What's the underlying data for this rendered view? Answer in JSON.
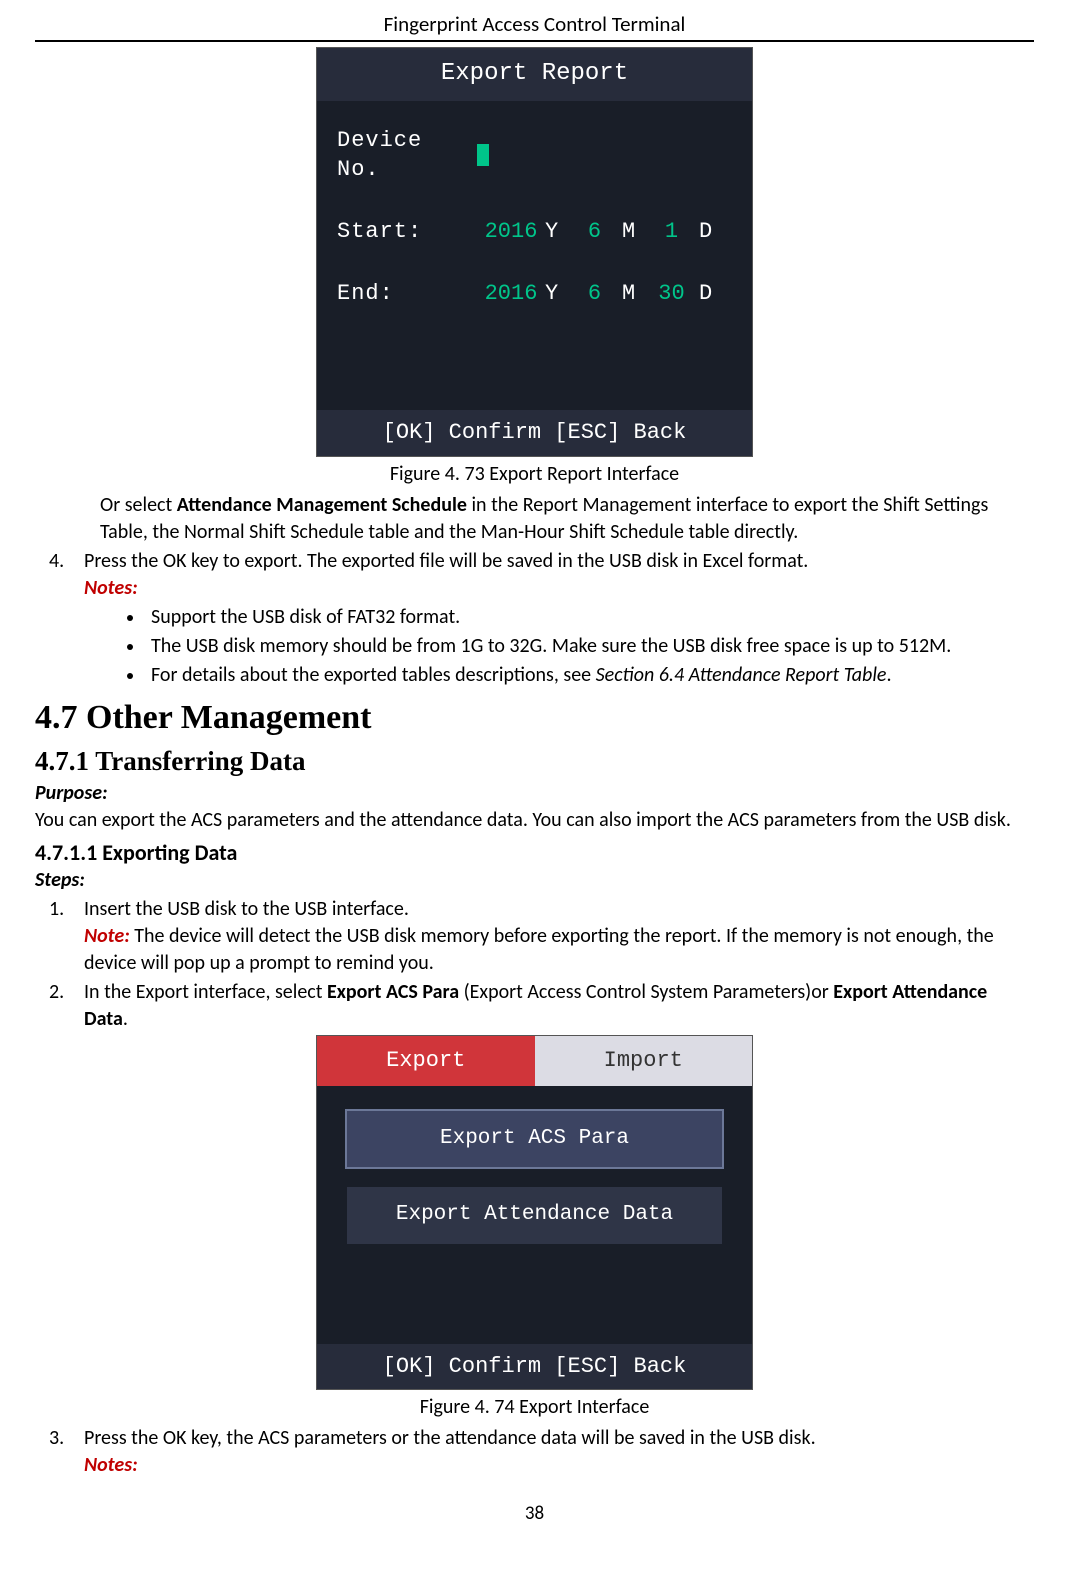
{
  "header": {
    "running_title": "Fingerprint Access Control Terminal"
  },
  "figure1": {
    "title": "Export Report",
    "fields": {
      "device_no_label": "Device No.",
      "start_label": "Start:",
      "end_label": "End:",
      "start": {
        "year": "2016",
        "y": "Y",
        "month": "6",
        "m": "M",
        "day": "1",
        "d": "D"
      },
      "end": {
        "year": "2016",
        "y": "Y",
        "month": "6",
        "m": "M",
        "day": "30",
        "d": "D"
      }
    },
    "footer": "[OK] Confirm   [ESC] Back",
    "caption_prefix": "Figure 4. 73",
    "caption_text": "Export Report Interface"
  },
  "para_after_fig1_a": "Or select ",
  "para_after_fig1_bold": "Attendance Management Schedule",
  "para_after_fig1_b": " in the Report Management interface to export the Shift Settings Table, the Normal Shift Schedule table and the Man-Hour Shift Schedule table directly.",
  "step4_num": "4.",
  "step4_text": "Press the OK key to export. The exported file will be saved in the USB disk in Excel format.",
  "notes_label": "Notes:",
  "notes_bullets": [
    "Support the USB disk of FAT32 format.",
    "The USB disk memory should be from 1G to 32G. Make sure the USB disk free space is up to 512M."
  ],
  "notes_bullet3_a": "For details about the exported tables descriptions, see ",
  "notes_bullet3_italic": "Section 6.4 Attendance Report Table",
  "notes_bullet3_b": ".",
  "h2": "4.7 Other Management",
  "h3": "4.7.1   Transferring Data",
  "purpose_label": "Purpose:",
  "purpose_text": "You can export the ACS parameters and the attendance data. You can also import the ACS parameters from the USB disk.",
  "h4": "4.7.1.1 Exporting Data",
  "steps_label": "Steps:",
  "step_b1_num": "1.",
  "step_b1_text": "Insert the USB disk to the USB interface.",
  "step_b1_note_label": "Note:",
  "step_b1_note_text": " The device will detect the USB disk memory before exporting the report. If the memory is not enough, the device will pop up a prompt to remind you.",
  "step_b2_num": "2.",
  "step_b2_a": "In the Export interface, select ",
  "step_b2_bold1": "Export ACS Para",
  "step_b2_mid": " (Export Access Control System Parameters)or ",
  "step_b2_bold2": "Export Attendance Data",
  "step_b2_end": ".",
  "figure2": {
    "tab_active": "Export",
    "tab_inactive": "Import",
    "opt1": "Export ACS Para",
    "opt2": "Export Attendance Data",
    "footer": "[OK] Confirm   [ESC] Back",
    "caption_prefix": "Figure 4. 74",
    "caption_text": "Export Interface"
  },
  "step_b3_num": "3.",
  "step_b3_text": "Press the OK key, the ACS parameters or the attendance data will be saved in the USB disk.",
  "notes_label_2": "Notes:",
  "page_number": "38"
}
